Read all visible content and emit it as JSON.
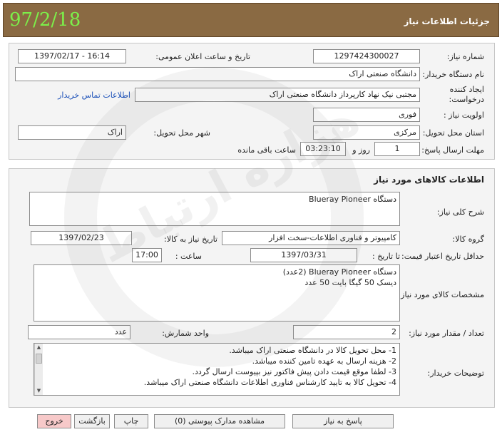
{
  "header": {
    "title": "جزئیات اطلاعات نیاز",
    "date": "97/2/18"
  },
  "watermark": {
    "text": "هزاره ارتباط"
  },
  "info": {
    "need_number_label": "شماره نیاز:",
    "need_number": "1297424300027",
    "announce_label": "تاریخ و ساعت اعلان عمومی:",
    "announce_value": "1397/02/17 - 16:14",
    "buyer_label": "نام دستگاه خریدار:",
    "buyer_value": "دانشگاه صنعتی اراک",
    "creator_label_1": "ایجاد کننده",
    "creator_label_2": "درخواست:",
    "creator_value": "مجتبی  نیک نهاد کارپرداز دانشگاه صنعتی اراک",
    "contact_link": "اطلاعات تماس خریدار",
    "priority_label": "اولویت نیاز :",
    "priority_value": "فوری",
    "province_label": "استان محل تحویل:",
    "province_value": "مرکزی",
    "city_label": "شهر محل تحویل:",
    "city_value": "اراک",
    "deadline_label": "مهلت ارسال پاسخ:",
    "deadline_days": "1",
    "days_word": "روز و",
    "deadline_time": "03:23:10",
    "remaining_word": "ساعت باقی مانده"
  },
  "goods": {
    "section_title": "اطلاعات کالاهای مورد نیاز",
    "desc_label": "شرح کلی نیاز:",
    "desc_value": "دستگاه Blueray Pioneer",
    "group_label": "گروه کالا:",
    "group_value": "کامپیوتر و فناوری اطلاعات-سخت افزار",
    "need_date_label": "تاریخ نیاز به کالا:",
    "need_date_value": "1397/02/23",
    "min_validity_label": "حداقل تاریخ اعتبار قیمت:",
    "until_label": "تا تاریخ :",
    "until_value": "1397/03/31",
    "time_label": "ساعت :",
    "time_value": "17:00",
    "spec_label": "مشخصات کالای مورد نیاز:",
    "spec_lines": [
      "دستگاه Blueray Pioneer (2عدد)",
      "دیسک 50 گیگا بایت 50 عدد"
    ],
    "qty_label": "تعداد / مقدار مورد نیاز:",
    "qty_value": "2",
    "unit_label": "واحد شمارش:",
    "unit_value": "عدد",
    "notes_label": "توضیحات خریدار:",
    "notes_lines": [
      "1- محل تحویل کالا در دانشگاه صنعتی اراک میباشد.",
      "2- هزینه ارسال به عهده تامین کننده میباشد.",
      "3- لطفا موقع قیمت دادن پیش فاکتور نیز بپیوست ارسال گردد.",
      "4- تحویل کالا به تایید کارشناس فناوری اطلاعات دانشگاه صنعتی اراک میباشد."
    ]
  },
  "buttons": {
    "reply": "پاسخ به نیاز",
    "attachments": "مشاهده مدارک پیوستی (0)",
    "print": "چاپ",
    "back": "بازگشت",
    "exit": "خروج"
  }
}
